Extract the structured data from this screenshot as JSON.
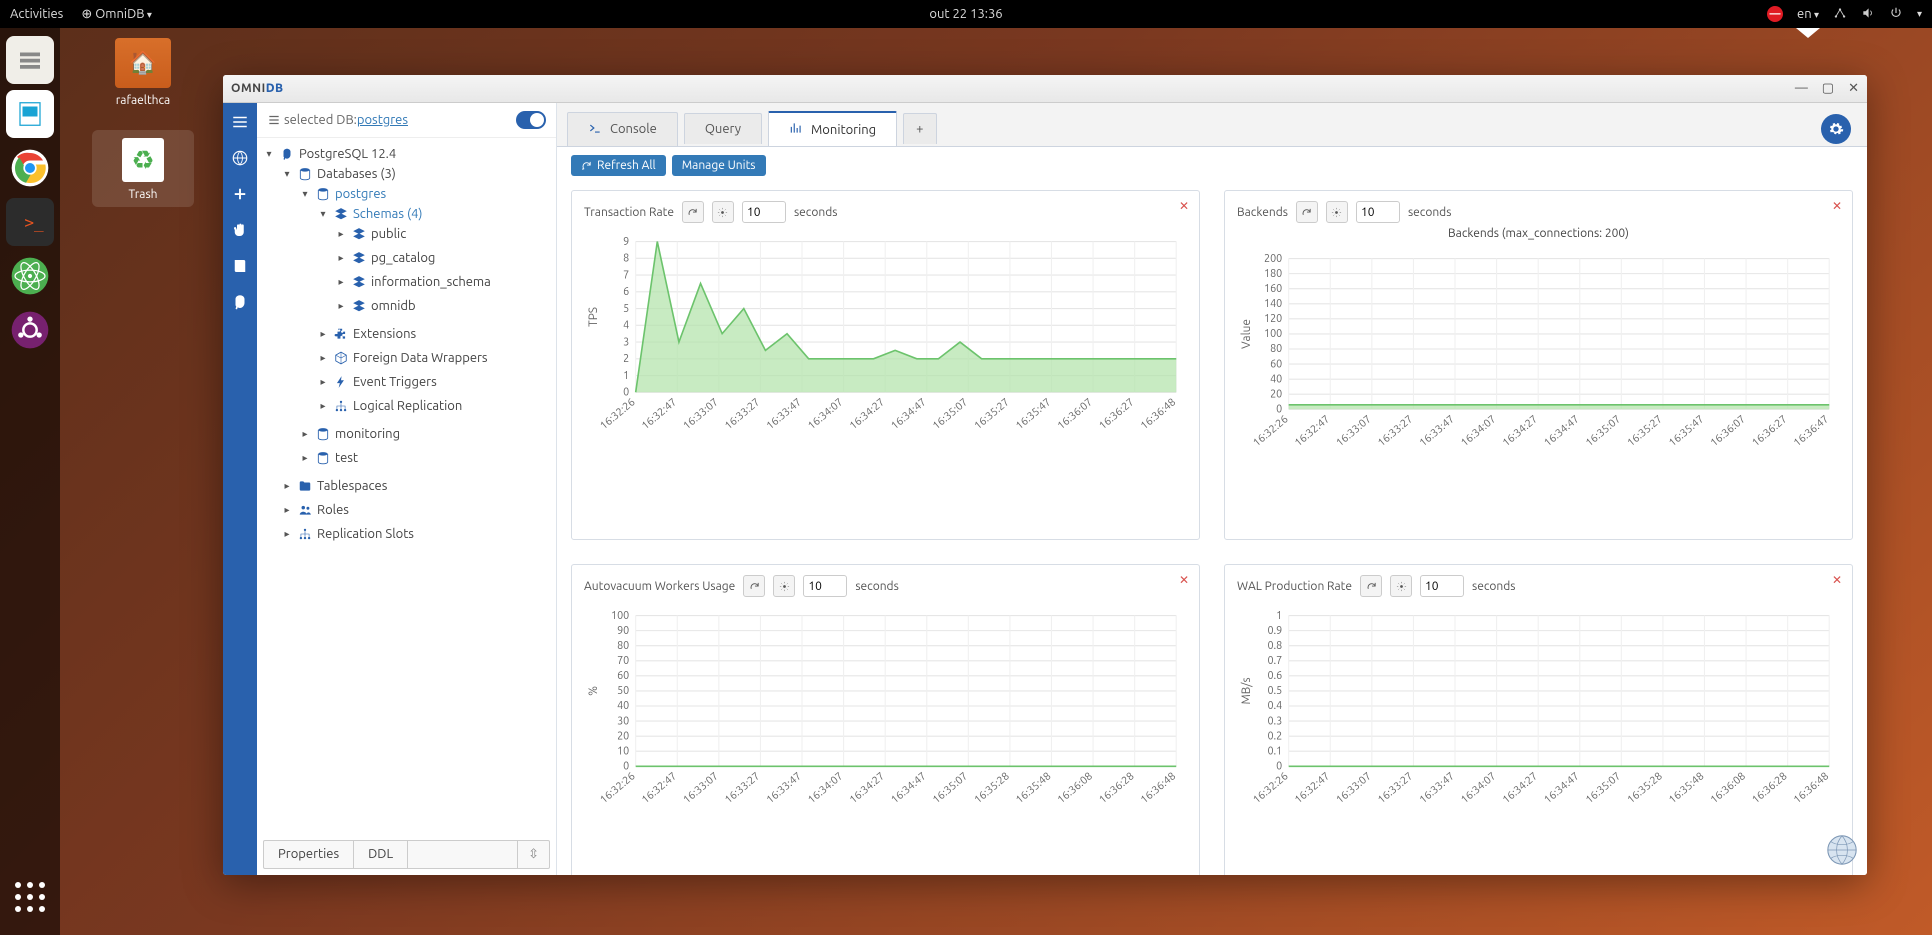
{
  "sysbar": {
    "activities": "Activities",
    "appmenu": "OmniDB",
    "clock": "out 22  13:36",
    "lang": "en"
  },
  "desktop": {
    "home_label": "rafaelthca",
    "trash_label": "Trash"
  },
  "window": {
    "title_a": "OMNI",
    "title_b": "DB"
  },
  "sidebar": {
    "selected_prefix": "selected DB: ",
    "selected_db": "postgres",
    "root": "PostgreSQL 12.4",
    "databases": "Databases (3)",
    "db_postgres": "postgres",
    "schemas": "Schemas (4)",
    "schema_public": "public",
    "schema_pgcatalog": "pg_catalog",
    "schema_infoschema": "information_schema",
    "schema_omnidb": "omnidb",
    "extensions": "Extensions",
    "fdw": "Foreign Data Wrappers",
    "event_triggers": "Event Triggers",
    "logical_repl": "Logical Replication",
    "db_monitoring": "monitoring",
    "db_test": "test",
    "tablespaces": "Tablespaces",
    "roles": "Roles",
    "replication_slots": "Replication Slots",
    "tab_properties": "Properties",
    "tab_ddl": "DDL"
  },
  "tabs": {
    "console": "Console",
    "query": "Query",
    "monitoring": "Monitoring"
  },
  "toolbar": {
    "refresh_all": "Refresh All",
    "manage_units": "Manage Units"
  },
  "units": {
    "tps": {
      "name": "Transaction Rate",
      "interval": "10",
      "seconds": "seconds"
    },
    "backends": {
      "name": "Backends",
      "interval": "10",
      "seconds": "seconds",
      "title": "Backends (max_connections: 200)"
    },
    "autovac": {
      "name": "Autovacuum Workers Usage",
      "interval": "10",
      "seconds": "seconds"
    },
    "wal": {
      "name": "WAL Production Rate",
      "interval": "10",
      "seconds": "seconds"
    }
  },
  "chart_data": [
    {
      "id": "tps",
      "type": "area",
      "title": "Transaction Rate",
      "ylabel": "TPS",
      "ylim": [
        0,
        9
      ],
      "yticks": [
        0,
        1,
        2,
        3,
        4,
        5,
        6,
        7,
        8,
        9
      ],
      "x": [
        "16:32:26",
        "16:32:47",
        "16:33:07",
        "16:33:27",
        "16:33:47",
        "16:34:07",
        "16:34:27",
        "16:34:47",
        "16:35:07",
        "16:35:27",
        "16:35:47",
        "16:36:07",
        "16:36:27",
        "16:36:48"
      ],
      "values": [
        0,
        9,
        3,
        6.5,
        3.5,
        5,
        2.5,
        3.5,
        2,
        2,
        2,
        2,
        2.5,
        2,
        2,
        3,
        2,
        2,
        2,
        2,
        2,
        2,
        2,
        2,
        2,
        2
      ],
      "color": "#b0e3a8"
    },
    {
      "id": "backends",
      "type": "area",
      "title": "Backends (max_connections: 200)",
      "ylabel": "Value",
      "ylim": [
        0,
        200
      ],
      "yticks": [
        0,
        20,
        40,
        60,
        80,
        100,
        120,
        140,
        160,
        180,
        200
      ],
      "x": [
        "16:32:26",
        "16:32:47",
        "16:33:07",
        "16:33:27",
        "16:33:47",
        "16:34:07",
        "16:34:27",
        "16:34:47",
        "16:35:07",
        "16:35:27",
        "16:35:47",
        "16:36:07",
        "16:36:27",
        "16:36:47"
      ],
      "values": [
        6,
        6,
        6,
        6,
        6,
        6,
        6,
        6,
        6,
        6,
        6,
        6,
        6,
        6
      ],
      "color": "#b0e3a8"
    },
    {
      "id": "autovac",
      "type": "area",
      "title": "Autovacuum Workers Usage",
      "ylabel": "%",
      "ylim": [
        0,
        100
      ],
      "yticks": [
        0,
        10,
        20,
        30,
        40,
        50,
        60,
        70,
        80,
        90,
        100
      ],
      "x": [
        "16:32:26",
        "16:32:47",
        "16:33:07",
        "16:33:27",
        "16:33:47",
        "16:34:07",
        "16:34:27",
        "16:34:47",
        "16:35:07",
        "16:35:28",
        "16:35:48",
        "16:36:08",
        "16:36:28",
        "16:36:48"
      ],
      "values": [
        0,
        0,
        0,
        0,
        0,
        0,
        0,
        0,
        0,
        0,
        0,
        0,
        0,
        0
      ],
      "color": "#b0e3a8"
    },
    {
      "id": "wal",
      "type": "area",
      "title": "WAL Production Rate",
      "ylabel": "MB/s",
      "ylim": [
        0,
        1.0
      ],
      "yticks": [
        0,
        0.1,
        0.2,
        0.3,
        0.4,
        0.5,
        0.6,
        0.7,
        0.8,
        0.9,
        1.0
      ],
      "x": [
        "16:32:26",
        "16:32:47",
        "16:33:07",
        "16:33:27",
        "16:33:47",
        "16:34:07",
        "16:34:27",
        "16:34:47",
        "16:35:07",
        "16:35:28",
        "16:35:48",
        "16:36:08",
        "16:36:28",
        "16:36:48"
      ],
      "values": [
        0,
        0,
        0,
        0,
        0,
        0,
        0,
        0,
        0,
        0,
        0,
        0,
        0,
        0
      ],
      "color": "#b0e3a8"
    }
  ]
}
